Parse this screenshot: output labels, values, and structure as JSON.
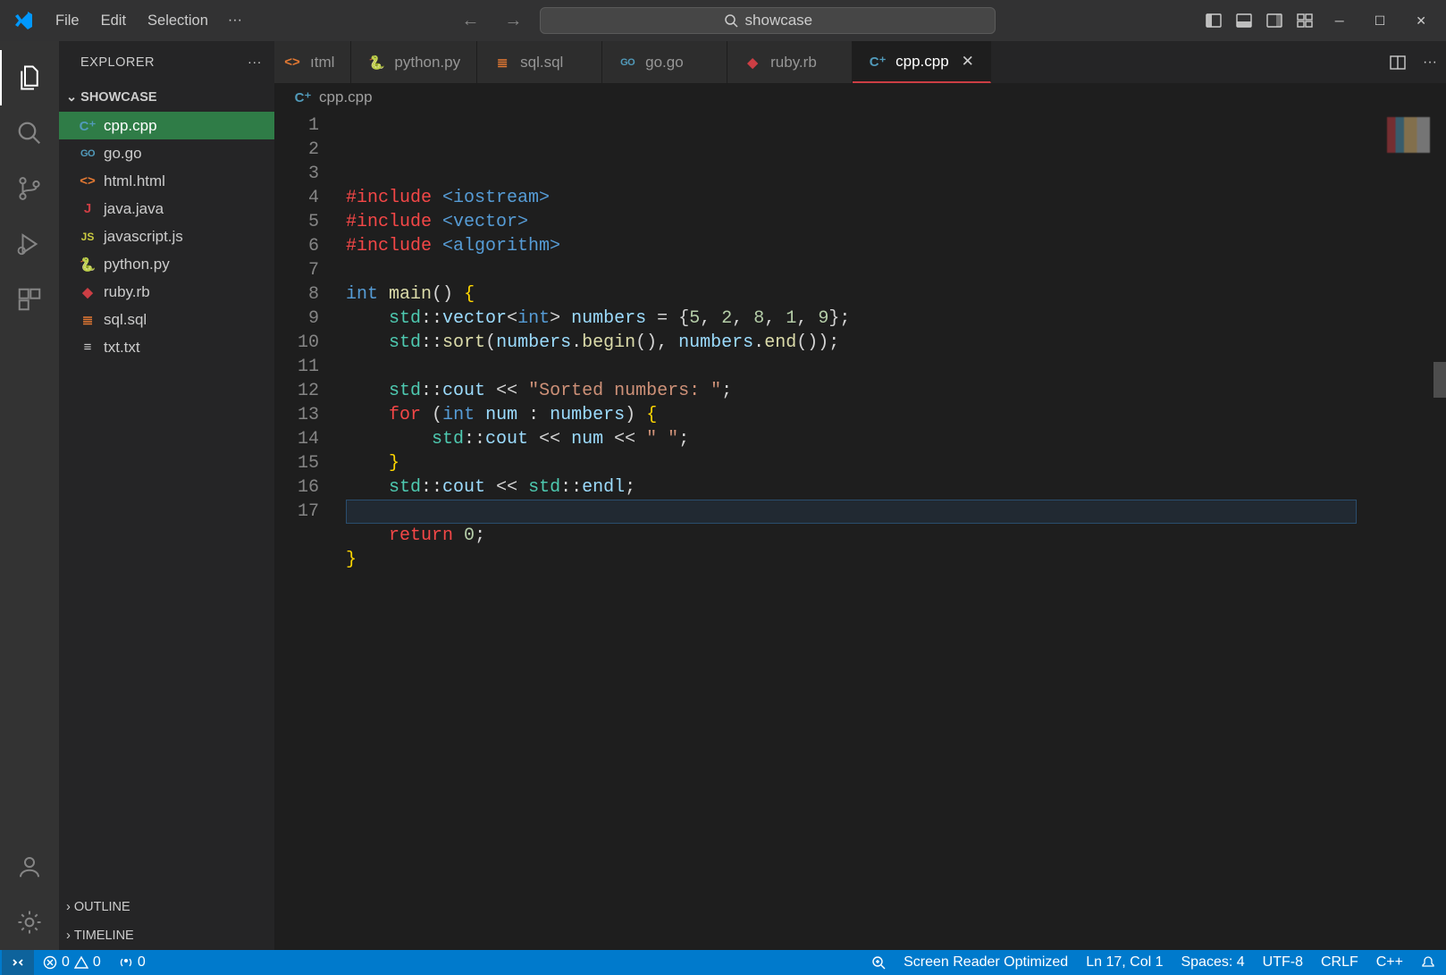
{
  "titlebar": {
    "menus": [
      "File",
      "Edit",
      "Selection"
    ],
    "command_center": "showcase"
  },
  "activitybar": {
    "items": [
      "explorer",
      "search",
      "source-control",
      "run-debug",
      "extensions"
    ],
    "bottom": [
      "accounts",
      "manage"
    ]
  },
  "sidebar": {
    "title": "EXPLORER",
    "folder": "SHOWCASE",
    "files": [
      {
        "name": "cpp.cpp",
        "icon": "cpp",
        "active": true
      },
      {
        "name": "go.go",
        "icon": "go"
      },
      {
        "name": "html.html",
        "icon": "html"
      },
      {
        "name": "java.java",
        "icon": "java"
      },
      {
        "name": "javascript.js",
        "icon": "js"
      },
      {
        "name": "python.py",
        "icon": "py"
      },
      {
        "name": "ruby.rb",
        "icon": "rb"
      },
      {
        "name": "sql.sql",
        "icon": "sql"
      },
      {
        "name": "txt.txt",
        "icon": "txt"
      }
    ],
    "sections": [
      "OUTLINE",
      "TIMELINE"
    ]
  },
  "tabs": [
    {
      "label": "ıtml",
      "icon": "html",
      "partial": true
    },
    {
      "label": "python.py",
      "icon": "py"
    },
    {
      "label": "sql.sql",
      "icon": "sql"
    },
    {
      "label": "go.go",
      "icon": "go"
    },
    {
      "label": "ruby.rb",
      "icon": "rb"
    },
    {
      "label": "cpp.cpp",
      "icon": "cpp",
      "active": true
    }
  ],
  "breadcrumb": {
    "icon": "cpp",
    "file": "cpp.cpp"
  },
  "code_lines": 17,
  "statusbar": {
    "errors": "0",
    "warnings": "0",
    "ports": "0",
    "screenreader": "Screen Reader Optimized",
    "position": "Ln 17, Col 1",
    "spaces": "Spaces: 4",
    "encoding": "UTF-8",
    "eol": "CRLF",
    "language": "C++"
  },
  "icon_glyphs": {
    "cpp": "C⁺",
    "go": "GO",
    "html": "<>",
    "java": "J",
    "js": "JS",
    "py": "🐍",
    "rb": "◆",
    "sql": "≣",
    "txt": "≡"
  }
}
